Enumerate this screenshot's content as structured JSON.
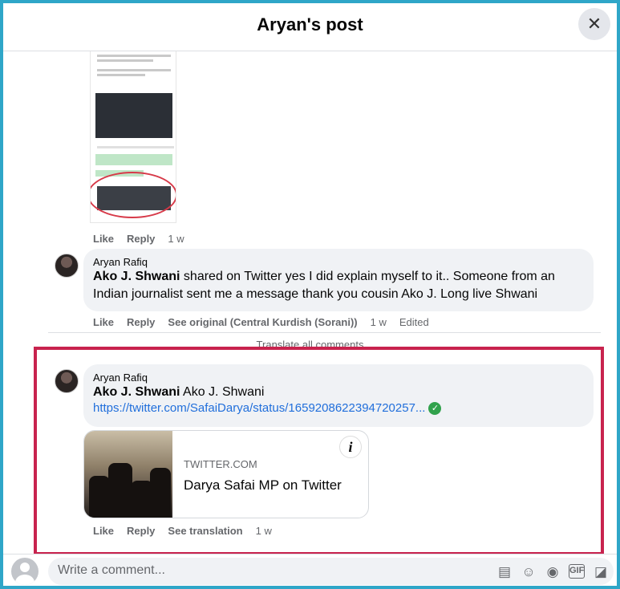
{
  "header": {
    "title": "Aryan's post",
    "close_label": "✕"
  },
  "comment_one_actions": {
    "like": "Like",
    "reply": "Reply",
    "time": "1 w"
  },
  "comment_two": {
    "author": "Aryan Rafiq",
    "mention": "Ako J. Shwani",
    "text": " shared on Twitter yes I did explain myself to it.. Someone from an Indian journalist sent me a message thank you cousin Ako J. Long live Shwani",
    "actions": {
      "like": "Like",
      "reply": "Reply",
      "see_original": "See original (Central Kurdish (Sorani))",
      "time": "1 w",
      "edited": "Edited"
    }
  },
  "translate_all": "Translate all comments",
  "comment_three": {
    "author": "Aryan Rafiq",
    "mention": "Ako J. Shwani",
    "text": " Ako J. Shwani",
    "link": "https://twitter.com/SafaiDarya/status/1659208622394720257...",
    "preview": {
      "domain": "TWITTER.COM",
      "title": "Darya Safai MP on Twitter",
      "info": "i"
    },
    "actions": {
      "like": "Like",
      "reply": "Reply",
      "see_translation": "See translation",
      "time": "1 w"
    }
  },
  "composer": {
    "placeholder": "Write a comment...",
    "icons": [
      "sticker-icon",
      "emoji-icon",
      "camera-icon",
      "gif-icon",
      "avatar-sticker-icon"
    ]
  },
  "colors": {
    "accent_border": "#c8234e",
    "frame": "#2fa6c8",
    "link": "#216fdb",
    "verified": "#31a24c"
  }
}
